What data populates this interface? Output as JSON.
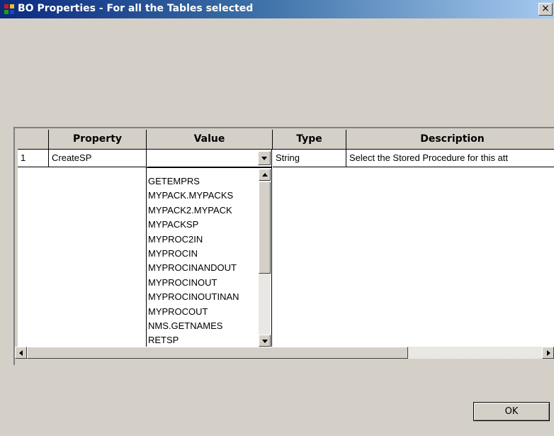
{
  "window": {
    "title": "BO Properties - For all the Tables selected",
    "close_glyph": "×"
  },
  "grid": {
    "columns": [
      "Property",
      "Value",
      "Type",
      "Description"
    ],
    "row_header_label": "",
    "rows": [
      {
        "row_number": "1",
        "property": "CreateSP",
        "value": "",
        "type": "String",
        "description": "Select the Stored Procedure for this att"
      }
    ]
  },
  "value_dropdown": {
    "options": [
      "GETEMPRS",
      "MYPACK.MYPACKS",
      "MYPACK2.MYPACK",
      "MYPACKSP",
      "MYPROC2IN",
      "MYPROCIN",
      "MYPROCINANDOUT",
      "MYPROCINOUT",
      "MYPROCINOUTINAN",
      "MYPROCOUT",
      "NMS.GETNAMES",
      "RETSP"
    ],
    "scroll_position": 0
  },
  "footer": {
    "ok_label": "OK"
  },
  "colors": {
    "dialog_background": "#d4d0c8",
    "titlebar_start": "#0b2a80",
    "titlebar_end": "#a6caf0",
    "title_text": "#ffffff"
  },
  "icons": {
    "app": "table-grid-icon",
    "close": "close-icon"
  }
}
